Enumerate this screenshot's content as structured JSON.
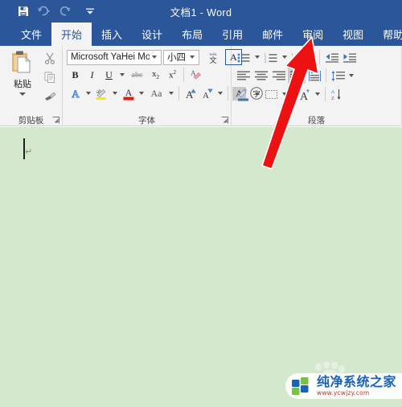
{
  "window": {
    "title": "文档1  -  Word",
    "titlebar_color": "#2b579a",
    "quick_access": [
      {
        "name": "save-icon",
        "label": "保存"
      },
      {
        "name": "undo-icon",
        "label": "撤消"
      },
      {
        "name": "redo-icon",
        "label": "恢复"
      },
      {
        "name": "customize-qat-icon",
        "label": "自定义快速访问工具栏"
      }
    ]
  },
  "tabs": [
    {
      "label": "文件",
      "active": false
    },
    {
      "label": "开始",
      "active": true
    },
    {
      "label": "插入",
      "active": false
    },
    {
      "label": "设计",
      "active": false
    },
    {
      "label": "布局",
      "active": false
    },
    {
      "label": "引用",
      "active": false
    },
    {
      "label": "邮件",
      "active": false
    },
    {
      "label": "审阅",
      "active": false
    },
    {
      "label": "视图",
      "active": false
    },
    {
      "label": "帮助",
      "active": false
    }
  ],
  "ribbon": {
    "clipboard": {
      "group_label": "剪贴板",
      "paste_label": "粘贴",
      "buttons": [
        {
          "name": "cut-icon",
          "label": "剪切"
        },
        {
          "name": "copy-icon",
          "label": "复制"
        },
        {
          "name": "format-painter-icon",
          "label": "格式刷"
        }
      ]
    },
    "font": {
      "group_label": "字体",
      "font_name": "Microsoft YaHei Mono",
      "font_size": "小四",
      "buttons": [
        {
          "name": "phonetic-guide-icon",
          "label": "拼音指南"
        },
        {
          "name": "character-border-icon",
          "label": "字符边框"
        },
        {
          "name": "bold-button",
          "label": "B"
        },
        {
          "name": "italic-button",
          "label": "I"
        },
        {
          "name": "underline-button",
          "label": "U"
        },
        {
          "name": "strikethrough-button",
          "label": "abc"
        },
        {
          "name": "subscript-button",
          "label": "x₂"
        },
        {
          "name": "superscript-button",
          "label": "x²"
        },
        {
          "name": "clear-formatting-icon",
          "label": "清除所有格式"
        },
        {
          "name": "text-effects-icon",
          "label": "文本效果和版式"
        },
        {
          "name": "text-highlight-icon",
          "label": "以不同颜色突出显示文本"
        },
        {
          "name": "font-color-icon",
          "label": "字体颜色"
        },
        {
          "name": "change-case-button",
          "label": "Aa"
        },
        {
          "name": "grow-font-button",
          "label": "A"
        },
        {
          "name": "shrink-font-button",
          "label": "A"
        },
        {
          "name": "character-shading-icon",
          "label": "字符底纹"
        },
        {
          "name": "enclose-character-icon",
          "label": "带圈字符"
        }
      ]
    },
    "paragraph": {
      "group_label": "段落",
      "buttons": [
        {
          "name": "bullets-icon",
          "label": "项目符号"
        },
        {
          "name": "numbering-icon",
          "label": "编号"
        },
        {
          "name": "multilevel-list-icon",
          "label": "多级列表"
        },
        {
          "name": "decrease-indent-icon",
          "label": "减少缩进量"
        },
        {
          "name": "increase-indent-icon",
          "label": "增加缩进量"
        },
        {
          "name": "align-left-icon",
          "label": "左对齐"
        },
        {
          "name": "align-center-icon",
          "label": "居中"
        },
        {
          "name": "align-right-icon",
          "label": "右对齐"
        },
        {
          "name": "justify-icon",
          "label": "两端对齐"
        },
        {
          "name": "distribute-icon",
          "label": "分散对齐"
        },
        {
          "name": "line-spacing-icon",
          "label": "行和段落间距"
        },
        {
          "name": "shading-icon",
          "label": "底纹"
        },
        {
          "name": "borders-icon",
          "label": "边框"
        },
        {
          "name": "show-formatting-marks-icon",
          "label": "显示编辑标记"
        },
        {
          "name": "sort-icon",
          "label": "排序"
        }
      ]
    }
  },
  "document": {
    "background_color": "#d3e8cd",
    "paragraph_mark": "↵"
  },
  "annotation": {
    "arrow_color": "#ee1111",
    "points_to": "审阅"
  },
  "watermark": {
    "title": "纯净系统之家",
    "url": "www.ycwjzy.com",
    "title_color": "#1a62b5",
    "url_color": "#c0392b"
  }
}
